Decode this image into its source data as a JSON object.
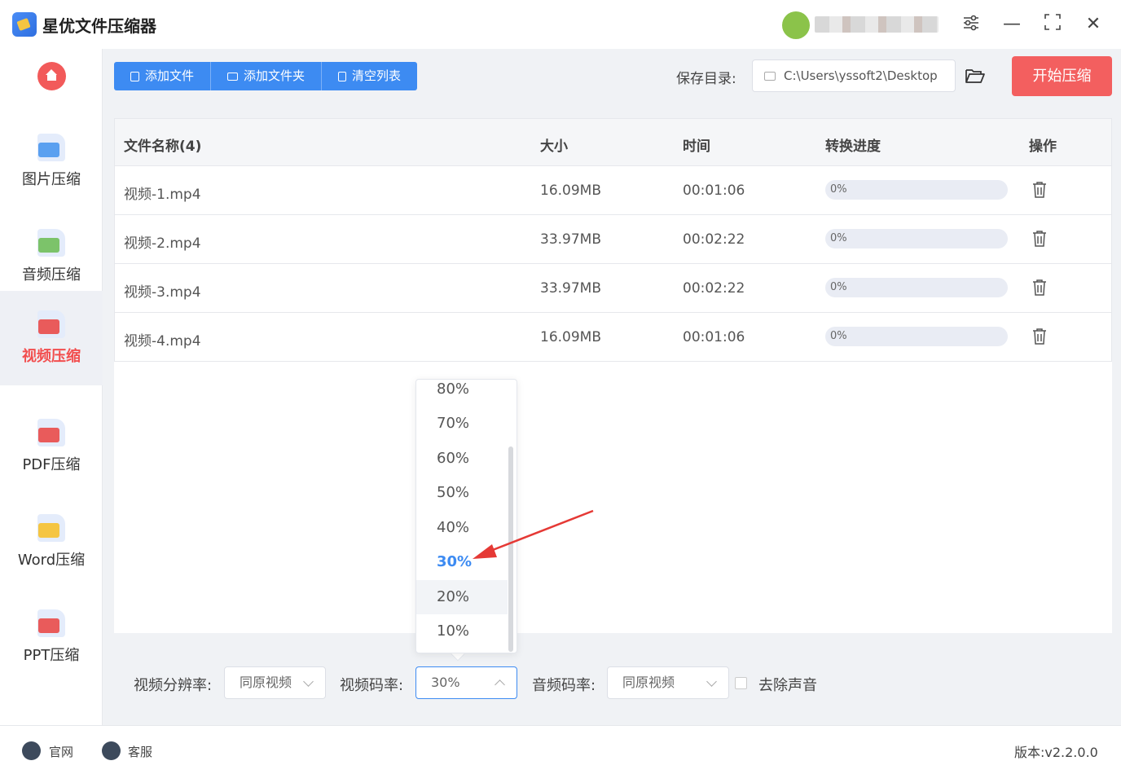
{
  "app": {
    "title": "星优文件压缩器"
  },
  "window": {
    "settings_icon": "sliders-icon",
    "minimize": "—",
    "maximize": "⛶",
    "close": "✕"
  },
  "sidebar": {
    "items": [
      {
        "label": "图片压缩",
        "icon": "image-icon",
        "color": "#5aa0f0"
      },
      {
        "label": "音频压缩",
        "icon": "music-icon",
        "color": "#7cc36a"
      },
      {
        "label": "视频压缩",
        "icon": "video-icon",
        "color": "#e95b5b",
        "active": true
      },
      {
        "label": "PDF压缩",
        "icon": "pdf-icon",
        "color": "#e95b5b"
      },
      {
        "label": "Word压缩",
        "icon": "word-icon",
        "color": "#f5c542"
      },
      {
        "label": "PPT压缩",
        "icon": "ppt-icon",
        "color": "#e95b5b"
      }
    ]
  },
  "toolbar": {
    "add_file": "添加文件",
    "add_folder": "添加文件夹",
    "clear_list": "清空列表",
    "save_label": "保存目录:",
    "save_path": "C:\\Users\\yssoft2\\Desktop",
    "start": "开始压缩"
  },
  "table": {
    "headers": {
      "name": "文件名称(4)",
      "size": "大小",
      "time": "时间",
      "progress": "转换进度",
      "action": "操作"
    },
    "rows": [
      {
        "name": "视频-1.mp4",
        "size": "16.09MB",
        "time": "00:01:06",
        "progress": "0%"
      },
      {
        "name": "视频-2.mp4",
        "size": "33.97MB",
        "time": "00:02:22",
        "progress": "0%"
      },
      {
        "name": "视频-3.mp4",
        "size": "33.97MB",
        "time": "00:02:22",
        "progress": "0%"
      },
      {
        "name": "视频-4.mp4",
        "size": "16.09MB",
        "time": "00:01:06",
        "progress": "0%"
      }
    ]
  },
  "dropdown": {
    "options": [
      "80%",
      "70%",
      "60%",
      "50%",
      "40%",
      "30%",
      "20%",
      "10%"
    ],
    "selected": "30%",
    "hovered": "20%"
  },
  "settings": {
    "resolution_label": "视频分辨率:",
    "resolution_value": "同原视频",
    "bitrate_label": "视频码率:",
    "bitrate_value": "30%",
    "audio_label": "音频码率:",
    "audio_value": "同原视频",
    "mute_label": "去除声音"
  },
  "footer": {
    "website": "官网",
    "support": "客服",
    "version": "版本:v2.2.0.0"
  },
  "colors": {
    "primary": "#3d8bf2",
    "accent": "#f35f5f",
    "arrow": "#e53935"
  }
}
